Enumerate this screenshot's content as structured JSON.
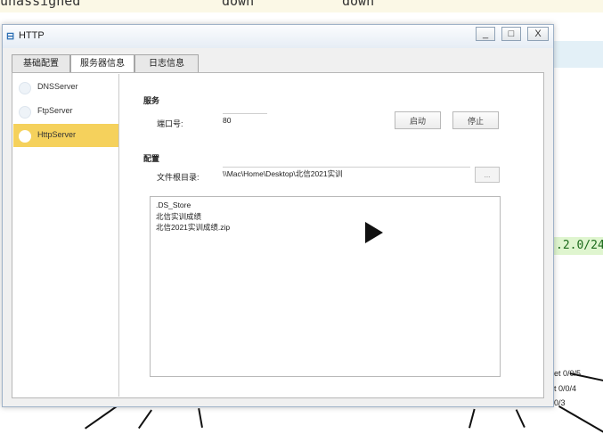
{
  "background": {
    "terminal_row": [
      "unassigned",
      "down",
      "down"
    ],
    "green_text": ".2.0/24",
    "ports": [
      "et 0/0/5",
      "t 0/0/4",
      "0/3"
    ]
  },
  "dialog": {
    "title": "HTTP",
    "window_buttons": {
      "minimize": "_",
      "maximize": "□",
      "close": "X"
    },
    "tabs": [
      "基础配置",
      "服务器信息",
      "日志信息"
    ],
    "active_tab": "服务器信息",
    "sidebar": {
      "items": [
        "DNSServer",
        "FtpServer",
        "HttpServer"
      ],
      "active": "HttpServer"
    },
    "service": {
      "section_title": "服务",
      "port_label": "端口号:",
      "port_value": "80",
      "start_button": "启动",
      "stop_button": "停止"
    },
    "config": {
      "section_title": "配置",
      "root_label": "文件根目录:",
      "root_value": "\\\\Mac\\Home\\Desktop\\北信2021实训",
      "browse_button": "..."
    },
    "files": [
      ".DS_Store",
      "北信实训成绩",
      "北信2021实训成绩.zip"
    ]
  },
  "colors": {
    "active_sidebar": "#f5d15c",
    "green_band": "#dff5cf"
  },
  "icons": {
    "title": "http-app-icon",
    "overlay": "play-icon"
  }
}
